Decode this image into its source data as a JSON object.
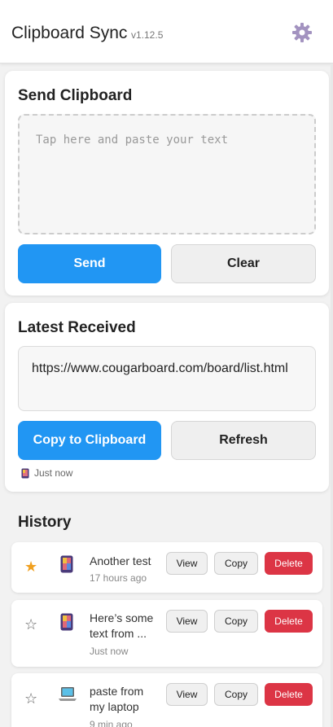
{
  "app": {
    "title": "Clipboard Sync",
    "version": "v1.12.5",
    "settings_icon": "gear-icon"
  },
  "send": {
    "title": "Send Clipboard",
    "placeholder": "Tap here and paste your text",
    "send_label": "Send",
    "clear_label": "Clear"
  },
  "received": {
    "title": "Latest Received",
    "content": "https://www.cougarboard.com/board/list.html",
    "copy_label": "Copy to Clipboard",
    "refresh_label": "Refresh",
    "device_icon": "phone-icon",
    "time": "Just now"
  },
  "history": {
    "title": "History",
    "items": [
      {
        "starred": true,
        "device": "phone",
        "text": "Another test",
        "time": "17 hours ago",
        "view": "View",
        "copy": "Copy",
        "delete": "Delete"
      },
      {
        "starred": false,
        "device": "phone",
        "text": "Here’s some text from ...",
        "time": "Just now",
        "view": "View",
        "copy": "Copy",
        "delete": "Delete"
      },
      {
        "starred": false,
        "device": "laptop",
        "text": "paste from my laptop",
        "time": "9 min ago",
        "view": "View",
        "copy": "Copy",
        "delete": "Delete"
      }
    ]
  },
  "colors": {
    "primary": "#2196f3",
    "danger": "#dc3545",
    "star": "#f0a020"
  }
}
